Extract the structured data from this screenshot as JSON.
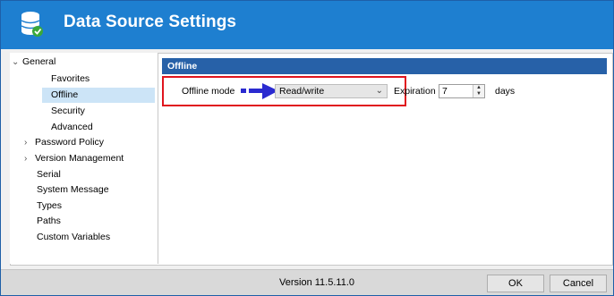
{
  "window": {
    "title": "Data Source Settings",
    "accent_color": "#1e7fd0",
    "icon": "database-check-icon"
  },
  "nav": {
    "items": [
      {
        "label": "General",
        "expanded": true,
        "chevron": "chevron-down-icon"
      },
      {
        "label": "Favorites"
      },
      {
        "label": "Offline",
        "selected": true
      },
      {
        "label": "Security"
      },
      {
        "label": "Advanced"
      },
      {
        "label": "Password Policy",
        "chevron": "chevron-right-icon"
      },
      {
        "label": "Version Management",
        "chevron": "chevron-right-icon"
      },
      {
        "label": "Serial"
      },
      {
        "label": "System Message"
      },
      {
        "label": "Types"
      },
      {
        "label": "Paths"
      },
      {
        "label": "Custom Variables"
      }
    ]
  },
  "offline": {
    "header": "Offline",
    "header_color": "#2761a8",
    "mode_label": "Offline mode",
    "mode_value": "Read/write",
    "expiration_label": "Expiration",
    "expiration_value": "7",
    "expiration_unit": "days",
    "highlight_color": "#e0141e",
    "pointer_icon": "blue-arrow-icon"
  },
  "footer": {
    "version": "Version 11.5.11.0",
    "ok_label": "OK",
    "cancel_label": "Cancel"
  }
}
